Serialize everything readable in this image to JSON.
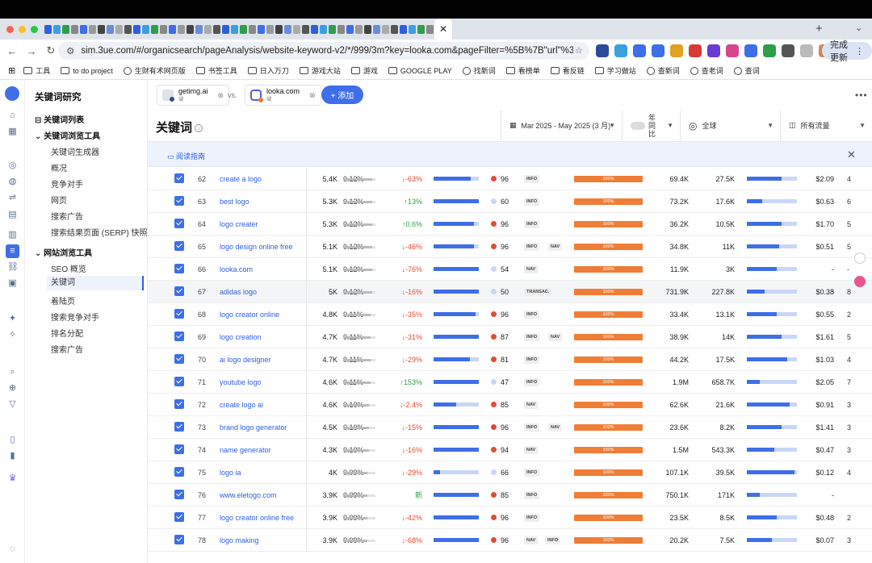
{
  "browser": {
    "url": "sim.3ue.com/#/organicsearch/pageAnalysis/website-keyword-v2/*/999/3m?key=looka.com&pageFilter=%5B%7B\"url\"%3A\"getimg.ai\"%2C\"sear...",
    "update_label": "完成更新",
    "bookmarks": [
      "工具",
      "to do project",
      "生财有术网页版",
      "书签工具",
      "日入万刀",
      "游戏大站",
      "游戏",
      "GOOGLE PLAY",
      "找新词",
      "看榜单",
      "看反链",
      "学习做站",
      "查新词",
      "查老词",
      "查词"
    ]
  },
  "sidebar": {
    "title": "关键词研究",
    "sections": [
      {
        "label": "关键词列表"
      },
      {
        "label": "关键词浏览工具",
        "items": [
          "关键词生成器",
          "概况",
          "竞争对手",
          "网页",
          "搜索广告",
          "搜索结果页面 (SERP) 快照"
        ]
      },
      {
        "label": "网站浏览工具",
        "items": [
          "SEO 概览",
          "关键词",
          "着陆页",
          "搜索竞争对手",
          "排名分配",
          "搜索广告"
        ]
      }
    ]
  },
  "compare": {
    "domain1": {
      "name": "getimg.ai",
      "type": "域"
    },
    "vs": "vs.",
    "domain2": {
      "name": "looka.com",
      "type": "域"
    },
    "add_label": "+ 添加"
  },
  "page": {
    "title": "关键词",
    "date_range": "Mar 2025 - May 2025 (3 月)",
    "yoy_label": "年同比",
    "region": "全球",
    "traffic": "所有流量",
    "guide": "阅读指南"
  },
  "colors": {
    "accent": "#3e6ee8",
    "up": "#2e9e4a",
    "down": "#e34b33",
    "orange": "#ef7d36"
  },
  "rows": [
    {
      "n": "62",
      "kw": "create a logo",
      "vol": "5.4K",
      "share": "0.12%",
      "share_frac": 0.9,
      "change": "-63%",
      "dir": "down",
      "ibar": 0.82,
      "kd": "96",
      "kdc": "#e34b33",
      "tags": [
        "INFO"
      ],
      "pct": "100%",
      "v1": "69.4K",
      "v2": "27.5K",
      "b2": 0.7,
      "cpc": "$2.09",
      "last": "4"
    },
    {
      "n": "63",
      "kw": "best logo",
      "vol": "5.3K",
      "share": "0.12%",
      "share_frac": 0.9,
      "change": "13%",
      "dir": "up",
      "ibar": 1.0,
      "kd": "60",
      "kdc": "#c9d7f7",
      "tags": [
        "INFO"
      ],
      "pct": "100%",
      "v1": "73.2K",
      "v2": "17.6K",
      "b2": 0.3,
      "cpc": "$0.63",
      "last": "6"
    },
    {
      "n": "64",
      "kw": "logo creater",
      "vol": "5.3K",
      "share": "0.12%",
      "share_frac": 0.9,
      "change": "0.6%",
      "dir": "up",
      "ibar": 0.9,
      "kd": "96",
      "kdc": "#e34b33",
      "tags": [
        "INFO"
      ],
      "pct": "100%",
      "v1": "36.2K",
      "v2": "10.5K",
      "b2": 0.7,
      "cpc": "$1.70",
      "last": "5"
    },
    {
      "n": "65",
      "kw": "logo design online free",
      "vol": "5.1K",
      "share": "0.12%",
      "share_frac": 0.9,
      "change": "-46%",
      "dir": "down",
      "ibar": 0.9,
      "kd": "96",
      "kdc": "#e34b33",
      "tags": [
        "INFO",
        "NAV"
      ],
      "pct": "100%",
      "v1": "34.8K",
      "v2": "11K",
      "b2": 0.65,
      "cpc": "$0.51",
      "last": "5"
    },
    {
      "n": "66",
      "kw": "looka.com",
      "vol": "5.1K",
      "share": "0.12%",
      "share_frac": 0.9,
      "change": "-76%",
      "dir": "down",
      "ibar": 1.0,
      "kd": "54",
      "kdc": "#c9d7f7",
      "tags": [
        "NAV"
      ],
      "pct": "100%",
      "v1": "11.9K",
      "v2": "3K",
      "b2": 0.6,
      "cpc": "-",
      "last": "-"
    },
    {
      "n": "67",
      "kw": "adidas logo",
      "vol": "5K",
      "share": "0.12%",
      "share_frac": 0.9,
      "change": "-16%",
      "dir": "down",
      "ibar": 1.0,
      "kd": "50",
      "kdc": "#c9d7f7",
      "tags": [
        "TRANSAC."
      ],
      "pct": "100%",
      "v1": "731.9K",
      "v2": "227.8K",
      "b2": 0.35,
      "cpc": "$0.38",
      "last": "8"
    },
    {
      "n": "68",
      "kw": "logo creator online",
      "vol": "4.8K",
      "share": "0.11%",
      "share_frac": 0.85,
      "change": "-35%",
      "dir": "down",
      "ibar": 0.92,
      "kd": "96",
      "kdc": "#e34b33",
      "tags": [
        "INFO"
      ],
      "pct": "100%",
      "v1": "33.4K",
      "v2": "13.1K",
      "b2": 0.6,
      "cpc": "$0.55",
      "last": "2"
    },
    {
      "n": "69",
      "kw": "logo creation",
      "vol": "4.7K",
      "share": "0.11%",
      "share_frac": 0.85,
      "change": "-31%",
      "dir": "down",
      "ibar": 1.0,
      "kd": "87",
      "kdc": "#e34b33",
      "tags": [
        "INFO",
        "NAV"
      ],
      "pct": "100%",
      "v1": "38.9K",
      "v2": "14K",
      "b2": 0.7,
      "cpc": "$1.61",
      "last": "5"
    },
    {
      "n": "70",
      "kw": "ai logo designer",
      "vol": "4.7K",
      "share": "0.11%",
      "share_frac": 0.85,
      "change": "-29%",
      "dir": "down",
      "ibar": 0.8,
      "kd": "81",
      "kdc": "#e34b33",
      "tags": [
        "INFO"
      ],
      "pct": "100%",
      "v1": "44.2K",
      "v2": "17.5K",
      "b2": 0.8,
      "cpc": "$1.03",
      "last": "4"
    },
    {
      "n": "71",
      "kw": "youtube logo",
      "vol": "4.6K",
      "share": "0.11%",
      "share_frac": 0.85,
      "change": "153%",
      "dir": "up",
      "ibar": 1.0,
      "kd": "47",
      "kdc": "#c9d7f7",
      "tags": [
        "INFO"
      ],
      "pct": "100%",
      "v1": "1.9M",
      "v2": "658.7K",
      "b2": 0.25,
      "cpc": "$2.05",
      "last": "7"
    },
    {
      "n": "72",
      "kw": "create logo ai",
      "vol": "4.6K",
      "share": "0.10%",
      "share_frac": 0.8,
      "change": "-2.4%",
      "dir": "down",
      "ibar": 0.5,
      "kd": "85",
      "kdc": "#e34b33",
      "tags": [
        "NAV"
      ],
      "pct": "100%",
      "v1": "62.6K",
      "v2": "21.6K",
      "b2": 0.85,
      "cpc": "$0.91",
      "last": "3"
    },
    {
      "n": "73",
      "kw": "brand logo generator",
      "vol": "4.5K",
      "share": "0.10%",
      "share_frac": 0.8,
      "change": "-15%",
      "dir": "down",
      "ibar": 1.0,
      "kd": "96",
      "kdc": "#e34b33",
      "tags": [
        "INFO",
        "NAV"
      ],
      "pct": "100%",
      "v1": "23.6K",
      "v2": "8.2K",
      "b2": 0.7,
      "cpc": "$1.41",
      "last": "3"
    },
    {
      "n": "74",
      "kw": "name generator",
      "vol": "4.3K",
      "share": "0.10%",
      "share_frac": 0.8,
      "change": "-16%",
      "dir": "down",
      "ibar": 1.0,
      "kd": "94",
      "kdc": "#e34b33",
      "tags": [
        "NAV"
      ],
      "pct": "100%",
      "v1": "1.5M",
      "v2": "543.3K",
      "b2": 0.55,
      "cpc": "$0.47",
      "last": "3"
    },
    {
      "n": "75",
      "kw": "logo ia",
      "vol": "4K",
      "share": "0.09%",
      "share_frac": 0.75,
      "change": "-29%",
      "dir": "down",
      "ibar": 0.15,
      "kd": "66",
      "kdc": "#c9d7f7",
      "tags": [
        "INFO"
      ],
      "pct": "100%",
      "v1": "107.1K",
      "v2": "39.5K",
      "b2": 0.95,
      "cpc": "$0.12",
      "last": "4"
    },
    {
      "n": "76",
      "kw": "www.eletogo.com",
      "vol": "3.9K",
      "share": "0.09%",
      "share_frac": 0.75,
      "change": "新",
      "dir": "new",
      "ibar": 1.0,
      "kd": "85",
      "kdc": "#e34b33",
      "tags": [
        "INFO"
      ],
      "pct": "100%",
      "v1": "750.1K",
      "v2": "171K",
      "b2": 0.25,
      "cpc": "-",
      "last": ""
    },
    {
      "n": "77",
      "kw": "logo creator online free",
      "vol": "3.9K",
      "share": "0.09%",
      "share_frac": 0.75,
      "change": "-42%",
      "dir": "down",
      "ibar": 1.0,
      "kd": "96",
      "kdc": "#e34b33",
      "tags": [
        "INFO"
      ],
      "pct": "100%",
      "v1": "23.5K",
      "v2": "8.5K",
      "b2": 0.6,
      "cpc": "$0.48",
      "last": "2"
    },
    {
      "n": "78",
      "kw": "logo making",
      "vol": "3.9K",
      "share": "0.09%",
      "share_frac": 0.75,
      "change": "-68%",
      "dir": "down",
      "ibar": 1.0,
      "kd": "96",
      "kdc": "#e34b33",
      "tags": [
        "NAV",
        "INFO"
      ],
      "pct": "100%",
      "v1": "20.2K",
      "v2": "7.5K",
      "b2": 0.5,
      "cpc": "$0.07",
      "last": "3"
    }
  ]
}
